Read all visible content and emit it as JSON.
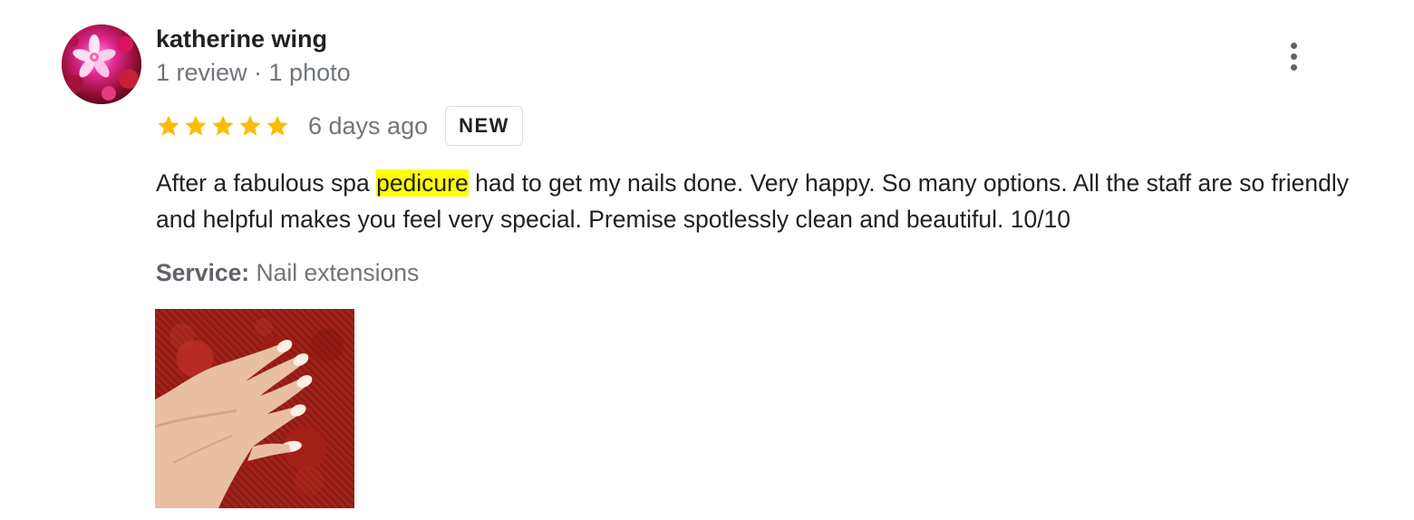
{
  "review": {
    "reviewer": {
      "name": "katherine wing",
      "meta": "1 review · 1 photo",
      "avatar_icon": "flower-avatar"
    },
    "rating": {
      "stars": 5,
      "max_stars": 5,
      "star_color": "#fbbc04"
    },
    "time": "6 days ago",
    "badge": "NEW",
    "text_parts": {
      "before": "After a fabulous spa ",
      "highlight": "pedicure",
      "after": " had to get my nails done. Very happy. So many options. All the staff are so friendly and helpful makes you feel very special. Premise spotlessly clean and beautiful. 10/10"
    },
    "highlight_color": "#ffff00",
    "service": {
      "label": "Service:",
      "value": "Nail extensions"
    },
    "photo": {
      "subject": "manicured-hand-on-red-towel"
    },
    "more_icon": "more-vert-icon"
  }
}
